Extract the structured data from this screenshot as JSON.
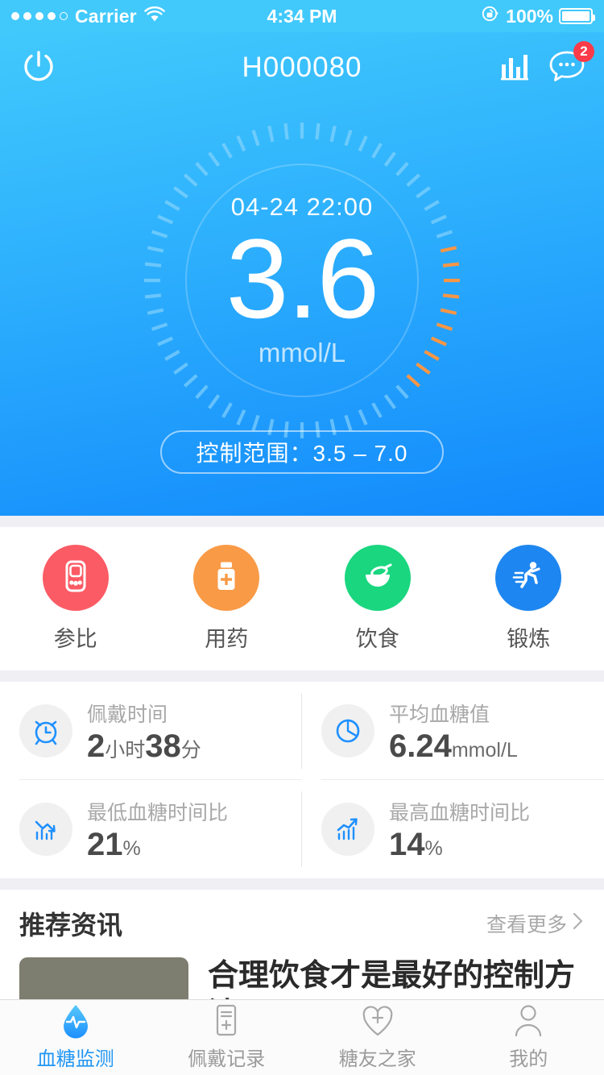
{
  "status_bar": {
    "carrier": "Carrier",
    "time": "4:34 PM",
    "battery_pct": "100%",
    "signal_dots_filled": 4,
    "signal_dots_total": 5,
    "wifi_icon": "wifi-icon",
    "rotation_lock_icon": "rotation-lock-icon",
    "battery_icon": "battery-full-icon"
  },
  "nav": {
    "title": "H000080",
    "power_icon": "power-icon",
    "chart_icon": "bar-chart-icon",
    "message_icon": "chat-bubble-icon",
    "message_badge": "2"
  },
  "gauge": {
    "timestamp": "04-24 22:00",
    "value": "3.6",
    "unit": "mmol/L",
    "range_label": "控制范围：3.5 – 7.0",
    "tick_total": 60,
    "highlight_start_index": 13,
    "highlight_end_index": 22,
    "tick_color": "#8FD6FB",
    "highlight_color": "#F79646"
  },
  "quick_actions": [
    {
      "label": "参比",
      "icon": "glucose-meter-icon",
      "color": "#FB5B64"
    },
    {
      "label": "用药",
      "icon": "pill-bottle-icon",
      "color": "#F99A46"
    },
    {
      "label": "饮食",
      "icon": "food-bowl-icon",
      "color": "#19D67F"
    },
    {
      "label": "锻炼",
      "icon": "runner-icon",
      "color": "#1E86F0"
    }
  ],
  "stats": [
    {
      "title": "佩戴时间",
      "value": "2",
      "unit": "小时",
      "value2": "38",
      "unit2": "分",
      "icon": "alarm-clock-icon"
    },
    {
      "title": "平均血糖值",
      "value": "6.24",
      "unit": "mmol/L",
      "value2": "",
      "unit2": "",
      "icon": "pie-chart-icon"
    },
    {
      "title": "最低血糖时间比",
      "value": "21",
      "unit": "%",
      "value2": "",
      "unit2": "",
      "icon": "chart-down-icon"
    },
    {
      "title": "最高血糖时间比",
      "value": "14",
      "unit": "%",
      "value2": "",
      "unit2": "",
      "icon": "chart-up-icon"
    }
  ],
  "news": {
    "section_title": "推荐资讯",
    "more_label": "查看更多",
    "more_icon": "chevron-right-icon",
    "article_title": "合理饮食才是最好的控制方法"
  },
  "tabs": [
    {
      "label": "血糖监测",
      "icon": "droplet-pulse-icon",
      "active": true
    },
    {
      "label": "佩戴记录",
      "icon": "record-add-icon",
      "active": false
    },
    {
      "label": "糖友之家",
      "icon": "heart-plus-icon",
      "active": false
    },
    {
      "label": "我的",
      "icon": "person-icon",
      "active": false
    }
  ],
  "colors": {
    "header_top": "#41C9FC",
    "header_bottom": "#1289FC",
    "accent": "#2196F3",
    "badge": "#FB3B49",
    "page_bg": "#efeff4"
  }
}
